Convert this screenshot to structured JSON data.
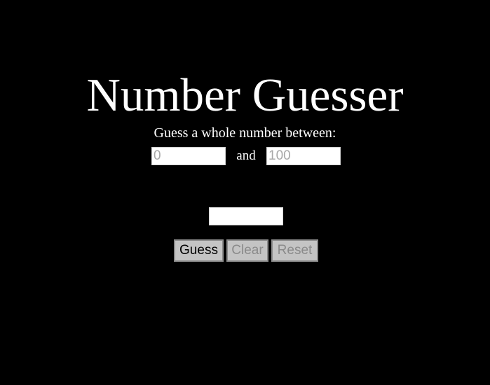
{
  "app": {
    "title": "Number Guesser",
    "subtitle": "Guess a whole number between:"
  },
  "range": {
    "min_placeholder": "0",
    "min_value": "",
    "and_label": "and",
    "max_placeholder": "100",
    "max_value": ""
  },
  "guess": {
    "placeholder": "",
    "value": ""
  },
  "buttons": {
    "guess_label": "Guess",
    "clear_label": "Clear",
    "reset_label": "Reset"
  },
  "colors": {
    "background": "#000000",
    "text": "#ffffff",
    "button_bg": "#c4c4c4",
    "button_disabled_text": "#8a8a8a"
  }
}
